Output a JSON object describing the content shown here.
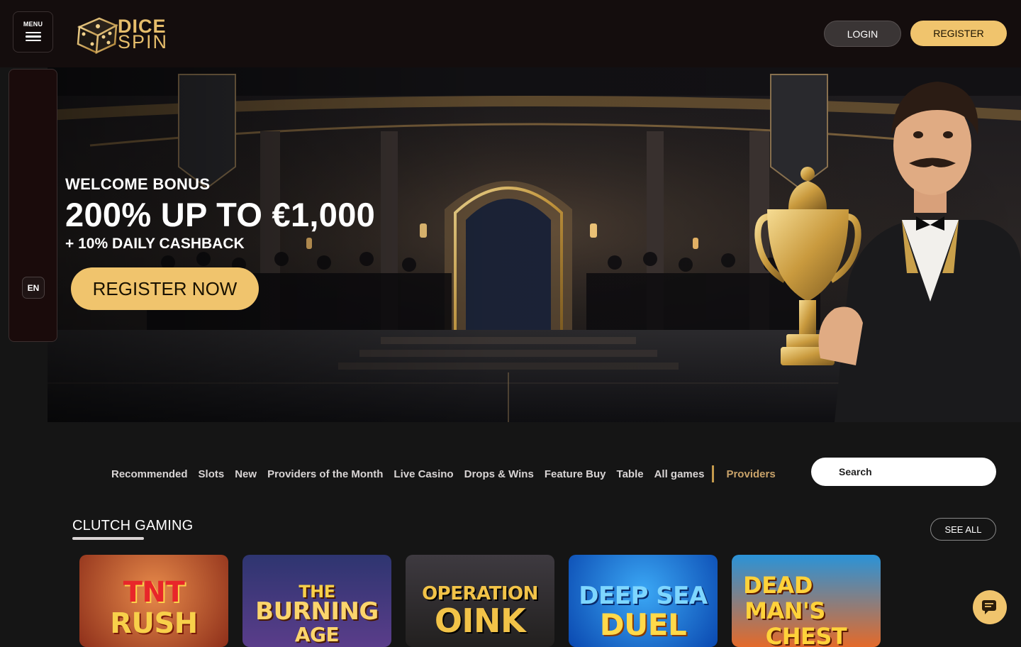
{
  "header": {
    "menu_label": "MENU",
    "logo_line1": "DICE",
    "logo_line2": "SPIN",
    "login_label": "LOGIN",
    "register_label": "REGISTER"
  },
  "sidebar": {
    "language": "EN"
  },
  "hero": {
    "subtitle": "WELCOME BONUS",
    "title": "200% UP TO €1,000",
    "cashback": "+ 10% DAILY CASHBACK",
    "cta_label": "REGISTER NOW"
  },
  "categories": {
    "items": [
      "Recommended",
      "Slots",
      "New",
      "Providers of the Month",
      "Live Casino",
      "Drops & Wins",
      "Feature Buy",
      "Table",
      "All games"
    ],
    "providers_label": "Providers",
    "search_placeholder": "Search"
  },
  "section": {
    "title": "CLUTCH GAMING",
    "see_all_label": "SEE ALL",
    "games": [
      {
        "line1": "TNT",
        "line2": "RUSH",
        "bg": "#c4532a"
      },
      {
        "line1": "THE",
        "line2": "BURNING",
        "line3": "AGE",
        "bg": "#3a2f6e"
      },
      {
        "line1": "OPERATION",
        "line2": "OINK",
        "bg": "#2e2a30"
      },
      {
        "line1": "DEEP SEA",
        "line2": "DUEL",
        "bg": "#1a78d8"
      },
      {
        "line1": "DEAD",
        "line2": "MAN'S",
        "line3": "CHEST",
        "bg": "#2f9ad6"
      }
    ]
  },
  "colors": {
    "accent": "#f0c46d",
    "header_bg": "#140d0d",
    "page_bg": "#151515"
  },
  "icons": {
    "menu": "hamburger-icon",
    "chat": "chat-icon",
    "logo": "dice-logo-icon"
  }
}
